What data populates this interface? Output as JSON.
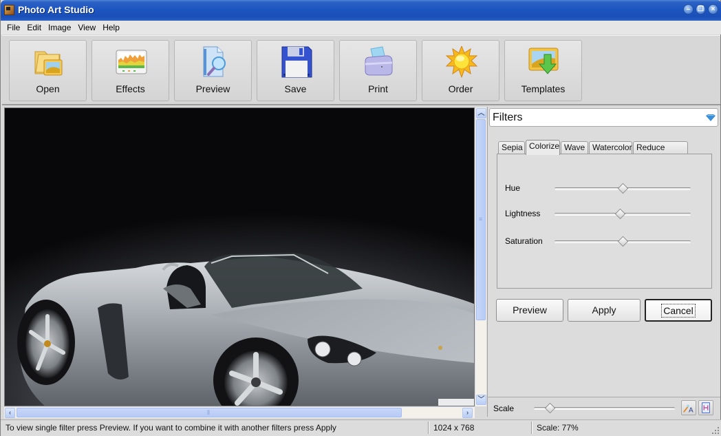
{
  "window": {
    "title": "Photo Art Studio",
    "controls": [
      "minimize",
      "restore",
      "close"
    ]
  },
  "menu": [
    {
      "label": "File",
      "accel": "F"
    },
    {
      "label": "Edit",
      "accel": "E"
    },
    {
      "label": "Image",
      "accel": "I"
    },
    {
      "label": "View",
      "accel": "V"
    },
    {
      "label": "Help",
      "accel": "H"
    }
  ],
  "toolbar": {
    "buttons": [
      {
        "label": "Open",
        "icon": "folder-image-icon"
      },
      {
        "label": "Effects",
        "icon": "effects-chart-icon"
      },
      {
        "label": "Preview",
        "icon": "document-magnifier-icon"
      },
      {
        "label": "Save",
        "icon": "floppy-disk-icon"
      },
      {
        "label": "Print",
        "icon": "printer-icon"
      },
      {
        "label": "Order",
        "icon": "sun-icon"
      },
      {
        "label": "Templates",
        "icon": "picture-download-icon"
      }
    ]
  },
  "canvas": {
    "image_description": "Silver convertible sports car on dark gradient background",
    "vscroll_position": 0,
    "hscroll_position": 0
  },
  "filters_panel": {
    "title": "Filters",
    "tabs": [
      {
        "label": "Sepia",
        "active": false
      },
      {
        "label": "Colorize",
        "active": true
      },
      {
        "label": "Wave",
        "active": false
      },
      {
        "label": "Watercolor",
        "active": false
      },
      {
        "label": "Reduce Colors",
        "active": false
      }
    ],
    "sliders": [
      {
        "label": "Hue",
        "value_pct": 50
      },
      {
        "label": "Lightness",
        "value_pct": 48
      },
      {
        "label": "Saturation",
        "value_pct": 50
      }
    ],
    "buttons": {
      "preview": "Preview",
      "apply": "Apply",
      "cancel": "Cancel"
    },
    "scale": {
      "label": "Scale",
      "value_pct": 11
    }
  },
  "statusbar": {
    "message": "To view single filter press Preview. If you want to combine it with another filters press Apply",
    "dimensions": "1024 x 768",
    "scale": "Scale: 77%"
  }
}
